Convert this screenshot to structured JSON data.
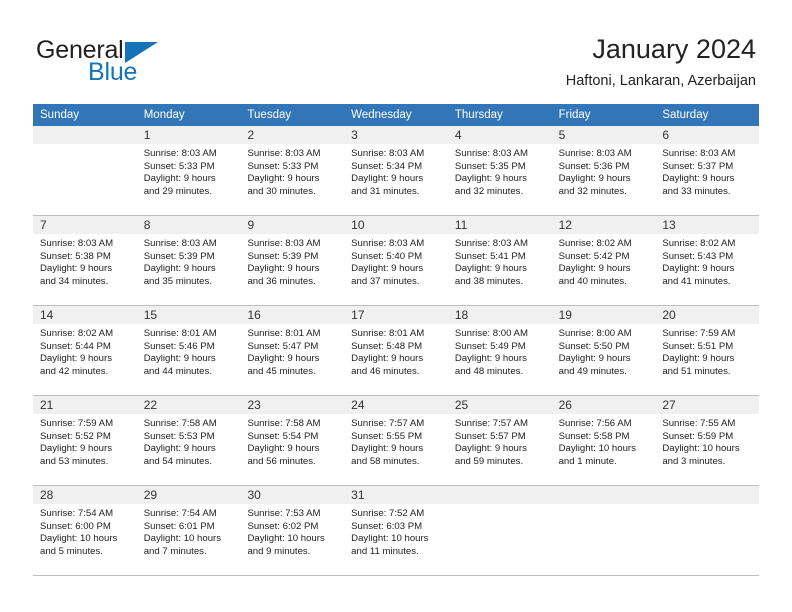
{
  "brand": {
    "name_part1": "General",
    "name_part2": "Blue",
    "triangle_icon": "blue-triangle-icon",
    "colors": {
      "dark": "#231f20",
      "blue": "#1574b8"
    }
  },
  "header": {
    "title": "January 2024",
    "subtitle": "Haftoni, Lankaran, Azerbaijan"
  },
  "calendar": {
    "header_bg": "#3276b8",
    "header_text_color": "#ffffff",
    "day_band_bg": "#f0f0f0",
    "weekdays": [
      "Sunday",
      "Monday",
      "Tuesday",
      "Wednesday",
      "Thursday",
      "Friday",
      "Saturday"
    ],
    "weeks": [
      [
        {
          "day": "",
          "sunrise": "",
          "sunset": "",
          "daylight_line1": "",
          "daylight_line2": ""
        },
        {
          "day": "1",
          "sunrise": "Sunrise: 8:03 AM",
          "sunset": "Sunset: 5:33 PM",
          "daylight_line1": "Daylight: 9 hours",
          "daylight_line2": "and 29 minutes."
        },
        {
          "day": "2",
          "sunrise": "Sunrise: 8:03 AM",
          "sunset": "Sunset: 5:33 PM",
          "daylight_line1": "Daylight: 9 hours",
          "daylight_line2": "and 30 minutes."
        },
        {
          "day": "3",
          "sunrise": "Sunrise: 8:03 AM",
          "sunset": "Sunset: 5:34 PM",
          "daylight_line1": "Daylight: 9 hours",
          "daylight_line2": "and 31 minutes."
        },
        {
          "day": "4",
          "sunrise": "Sunrise: 8:03 AM",
          "sunset": "Sunset: 5:35 PM",
          "daylight_line1": "Daylight: 9 hours",
          "daylight_line2": "and 32 minutes."
        },
        {
          "day": "5",
          "sunrise": "Sunrise: 8:03 AM",
          "sunset": "Sunset: 5:36 PM",
          "daylight_line1": "Daylight: 9 hours",
          "daylight_line2": "and 32 minutes."
        },
        {
          "day": "6",
          "sunrise": "Sunrise: 8:03 AM",
          "sunset": "Sunset: 5:37 PM",
          "daylight_line1": "Daylight: 9 hours",
          "daylight_line2": "and 33 minutes."
        }
      ],
      [
        {
          "day": "7",
          "sunrise": "Sunrise: 8:03 AM",
          "sunset": "Sunset: 5:38 PM",
          "daylight_line1": "Daylight: 9 hours",
          "daylight_line2": "and 34 minutes."
        },
        {
          "day": "8",
          "sunrise": "Sunrise: 8:03 AM",
          "sunset": "Sunset: 5:39 PM",
          "daylight_line1": "Daylight: 9 hours",
          "daylight_line2": "and 35 minutes."
        },
        {
          "day": "9",
          "sunrise": "Sunrise: 8:03 AM",
          "sunset": "Sunset: 5:39 PM",
          "daylight_line1": "Daylight: 9 hours",
          "daylight_line2": "and 36 minutes."
        },
        {
          "day": "10",
          "sunrise": "Sunrise: 8:03 AM",
          "sunset": "Sunset: 5:40 PM",
          "daylight_line1": "Daylight: 9 hours",
          "daylight_line2": "and 37 minutes."
        },
        {
          "day": "11",
          "sunrise": "Sunrise: 8:03 AM",
          "sunset": "Sunset: 5:41 PM",
          "daylight_line1": "Daylight: 9 hours",
          "daylight_line2": "and 38 minutes."
        },
        {
          "day": "12",
          "sunrise": "Sunrise: 8:02 AM",
          "sunset": "Sunset: 5:42 PM",
          "daylight_line1": "Daylight: 9 hours",
          "daylight_line2": "and 40 minutes."
        },
        {
          "day": "13",
          "sunrise": "Sunrise: 8:02 AM",
          "sunset": "Sunset: 5:43 PM",
          "daylight_line1": "Daylight: 9 hours",
          "daylight_line2": "and 41 minutes."
        }
      ],
      [
        {
          "day": "14",
          "sunrise": "Sunrise: 8:02 AM",
          "sunset": "Sunset: 5:44 PM",
          "daylight_line1": "Daylight: 9 hours",
          "daylight_line2": "and 42 minutes."
        },
        {
          "day": "15",
          "sunrise": "Sunrise: 8:01 AM",
          "sunset": "Sunset: 5:46 PM",
          "daylight_line1": "Daylight: 9 hours",
          "daylight_line2": "and 44 minutes."
        },
        {
          "day": "16",
          "sunrise": "Sunrise: 8:01 AM",
          "sunset": "Sunset: 5:47 PM",
          "daylight_line1": "Daylight: 9 hours",
          "daylight_line2": "and 45 minutes."
        },
        {
          "day": "17",
          "sunrise": "Sunrise: 8:01 AM",
          "sunset": "Sunset: 5:48 PM",
          "daylight_line1": "Daylight: 9 hours",
          "daylight_line2": "and 46 minutes."
        },
        {
          "day": "18",
          "sunrise": "Sunrise: 8:00 AM",
          "sunset": "Sunset: 5:49 PM",
          "daylight_line1": "Daylight: 9 hours",
          "daylight_line2": "and 48 minutes."
        },
        {
          "day": "19",
          "sunrise": "Sunrise: 8:00 AM",
          "sunset": "Sunset: 5:50 PM",
          "daylight_line1": "Daylight: 9 hours",
          "daylight_line2": "and 49 minutes."
        },
        {
          "day": "20",
          "sunrise": "Sunrise: 7:59 AM",
          "sunset": "Sunset: 5:51 PM",
          "daylight_line1": "Daylight: 9 hours",
          "daylight_line2": "and 51 minutes."
        }
      ],
      [
        {
          "day": "21",
          "sunrise": "Sunrise: 7:59 AM",
          "sunset": "Sunset: 5:52 PM",
          "daylight_line1": "Daylight: 9 hours",
          "daylight_line2": "and 53 minutes."
        },
        {
          "day": "22",
          "sunrise": "Sunrise: 7:58 AM",
          "sunset": "Sunset: 5:53 PM",
          "daylight_line1": "Daylight: 9 hours",
          "daylight_line2": "and 54 minutes."
        },
        {
          "day": "23",
          "sunrise": "Sunrise: 7:58 AM",
          "sunset": "Sunset: 5:54 PM",
          "daylight_line1": "Daylight: 9 hours",
          "daylight_line2": "and 56 minutes."
        },
        {
          "day": "24",
          "sunrise": "Sunrise: 7:57 AM",
          "sunset": "Sunset: 5:55 PM",
          "daylight_line1": "Daylight: 9 hours",
          "daylight_line2": "and 58 minutes."
        },
        {
          "day": "25",
          "sunrise": "Sunrise: 7:57 AM",
          "sunset": "Sunset: 5:57 PM",
          "daylight_line1": "Daylight: 9 hours",
          "daylight_line2": "and 59 minutes."
        },
        {
          "day": "26",
          "sunrise": "Sunrise: 7:56 AM",
          "sunset": "Sunset: 5:58 PM",
          "daylight_line1": "Daylight: 10 hours",
          "daylight_line2": "and 1 minute."
        },
        {
          "day": "27",
          "sunrise": "Sunrise: 7:55 AM",
          "sunset": "Sunset: 5:59 PM",
          "daylight_line1": "Daylight: 10 hours",
          "daylight_line2": "and 3 minutes."
        }
      ],
      [
        {
          "day": "28",
          "sunrise": "Sunrise: 7:54 AM",
          "sunset": "Sunset: 6:00 PM",
          "daylight_line1": "Daylight: 10 hours",
          "daylight_line2": "and 5 minutes."
        },
        {
          "day": "29",
          "sunrise": "Sunrise: 7:54 AM",
          "sunset": "Sunset: 6:01 PM",
          "daylight_line1": "Daylight: 10 hours",
          "daylight_line2": "and 7 minutes."
        },
        {
          "day": "30",
          "sunrise": "Sunrise: 7:53 AM",
          "sunset": "Sunset: 6:02 PM",
          "daylight_line1": "Daylight: 10 hours",
          "daylight_line2": "and 9 minutes."
        },
        {
          "day": "31",
          "sunrise": "Sunrise: 7:52 AM",
          "sunset": "Sunset: 6:03 PM",
          "daylight_line1": "Daylight: 10 hours",
          "daylight_line2": "and 11 minutes."
        },
        {
          "day": "",
          "sunrise": "",
          "sunset": "",
          "daylight_line1": "",
          "daylight_line2": ""
        },
        {
          "day": "",
          "sunrise": "",
          "sunset": "",
          "daylight_line1": "",
          "daylight_line2": ""
        },
        {
          "day": "",
          "sunrise": "",
          "sunset": "",
          "daylight_line1": "",
          "daylight_line2": ""
        }
      ]
    ]
  }
}
